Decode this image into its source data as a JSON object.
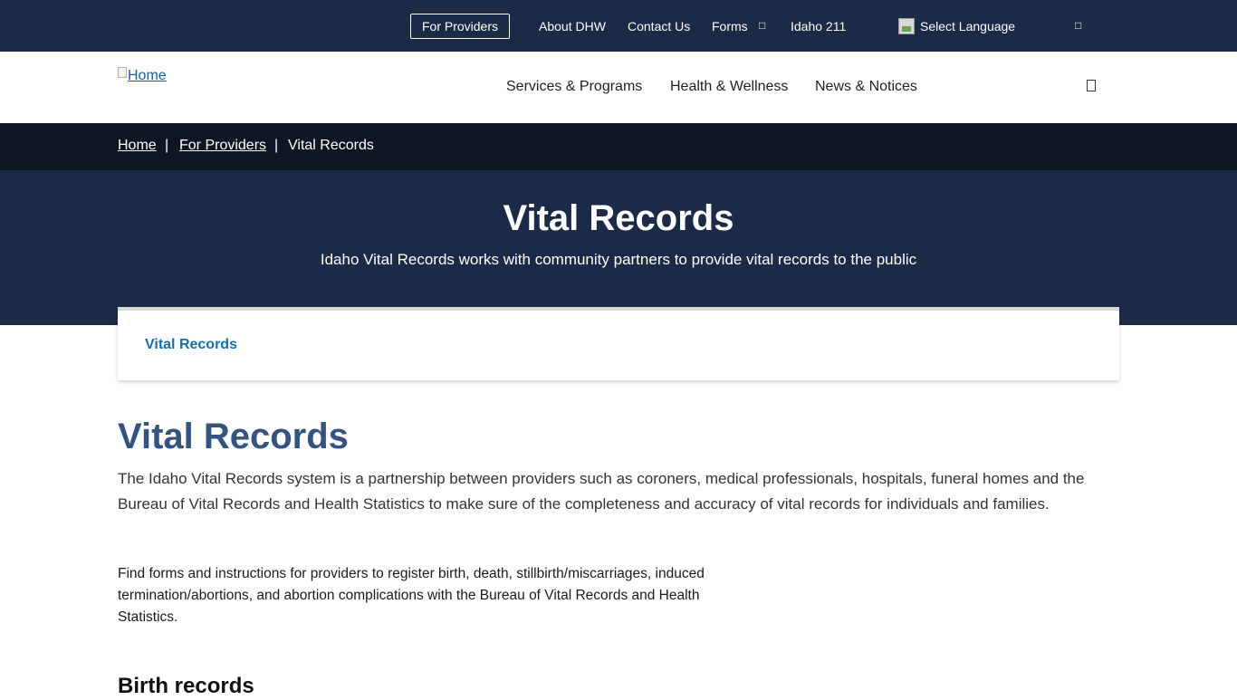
{
  "topbar": {
    "providers_button": "For Providers",
    "about": "About DHW",
    "contact": "Contact Us",
    "forms": "Forms",
    "idaho211": "Idaho 211",
    "language": "Select Language",
    "forms_icon": "external-link-icon",
    "account_icon": "user-icon"
  },
  "header": {
    "logo_alt": "Home",
    "nav": [
      "Services & Programs",
      "Health & Wellness",
      "News & Notices"
    ],
    "search_icon": "search-icon"
  },
  "breadcrumb": {
    "items": [
      "Home",
      "For Providers",
      "Vital Records"
    ],
    "separator": "|"
  },
  "hero": {
    "title": "Vital Records",
    "subtitle": "Idaho Vital Records works with community partners to provide vital records to the public"
  },
  "card": {
    "link": "Vital Records"
  },
  "content": {
    "heading": "Vital Records",
    "intro": "The Idaho Vital Records system is a partnership between providers such as coroners, medical professionals, hospitals, funeral homes and the Bureau of Vital Records and Health Statistics to make sure of the completeness and accuracy of vital records for individuals and families.",
    "paragraph": "Find forms and instructions for providers to register birth, death, stillbirth/miscarriages, induced termination/abortions, and abortion complications with the Bureau of Vital Records and Health Statistics.",
    "subheading": "Birth records"
  },
  "colors": {
    "navy": "#1b2a47",
    "breadcrumb_bg": "#0e1624",
    "heading_blue": "#34537f",
    "link_blue": "#1570a6"
  }
}
